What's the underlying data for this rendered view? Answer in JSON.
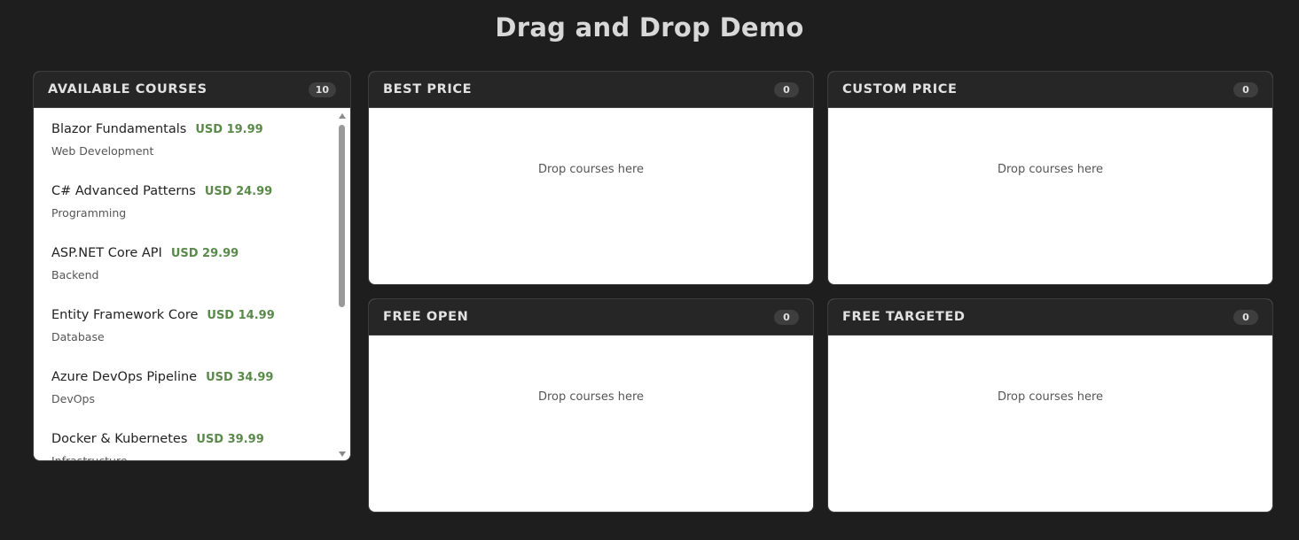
{
  "page": {
    "title": "Drag and Drop Demo"
  },
  "available": {
    "title": "AVAILABLE COURSES",
    "count": "10",
    "courses": [
      {
        "name": "Blazor Fundamentals",
        "price": "USD 19.99",
        "category": "Web Development"
      },
      {
        "name": "C# Advanced Patterns",
        "price": "USD 24.99",
        "category": "Programming"
      },
      {
        "name": "ASP.NET Core API",
        "price": "USD 29.99",
        "category": "Backend"
      },
      {
        "name": "Entity Framework Core",
        "price": "USD 14.99",
        "category": "Database"
      },
      {
        "name": "Azure DevOps Pipeline",
        "price": "USD 34.99",
        "category": "DevOps"
      },
      {
        "name": "Docker & Kubernetes",
        "price": "USD 39.99",
        "category": "Infrastructure"
      }
    ],
    "scroll_position": 0
  },
  "zones": {
    "best": {
      "title": "BEST PRICE",
      "count": "0",
      "hint": "Drop courses here"
    },
    "custom": {
      "title": "CUSTOM PRICE",
      "count": "0",
      "hint": "Drop courses here"
    },
    "freeopen": {
      "title": "FREE OPEN",
      "count": "0",
      "hint": "Drop courses here"
    },
    "freetargeted": {
      "title": "FREE TARGETED",
      "count": "0",
      "hint": "Drop courses here"
    }
  },
  "colors": {
    "background": "#1e1e1e",
    "header": "#262626",
    "price": "#5a8a4a"
  }
}
